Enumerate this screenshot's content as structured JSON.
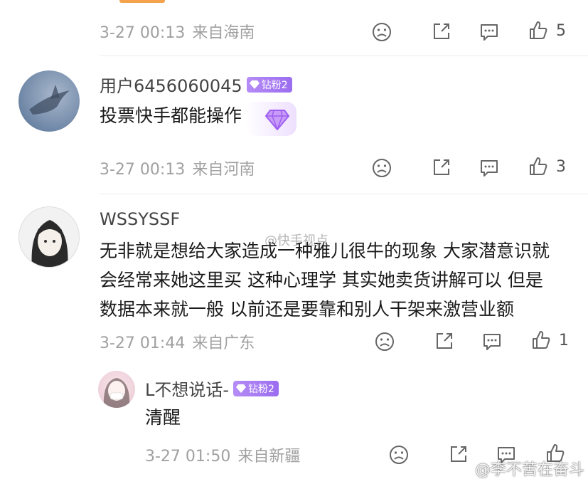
{
  "comments": [
    {
      "date": "3-27 00:13",
      "location": "来自海南",
      "likes": "5"
    },
    {
      "username": "用户6456060045",
      "badge": "钻粉2",
      "text": "投票快手都能操作",
      "date": "3-27 00:13",
      "location": "来自河南",
      "likes": "3"
    },
    {
      "username": "WSSYSSF",
      "text_lines": [
        "无非就是想给大家造成一种雅儿很牛的现象 大家潜意识就",
        "会经常来她这里买 这种心理学  其实她卖货讲解可以 但是",
        "数据本来就一般  以前还是要靠和别人干架来激营业额"
      ],
      "date": "3-27 01:44",
      "location": "来自广东",
      "likes": "1"
    },
    {
      "username": "L不想说话-",
      "badge": "钻粉2",
      "text": "清醒",
      "date": "3-27 01:50",
      "location": "来自新疆",
      "likes": ""
    }
  ],
  "watermarks": {
    "center": "@快手视点",
    "bottom_right": "@李不苦在奋斗"
  },
  "icons": [
    "dislike-icon",
    "share-icon",
    "reply-icon",
    "like-icon",
    "gem-icon"
  ],
  "colors": {
    "badge": "#a47af2",
    "meta": "#a0a0a0",
    "text": "#1a1a1a"
  }
}
